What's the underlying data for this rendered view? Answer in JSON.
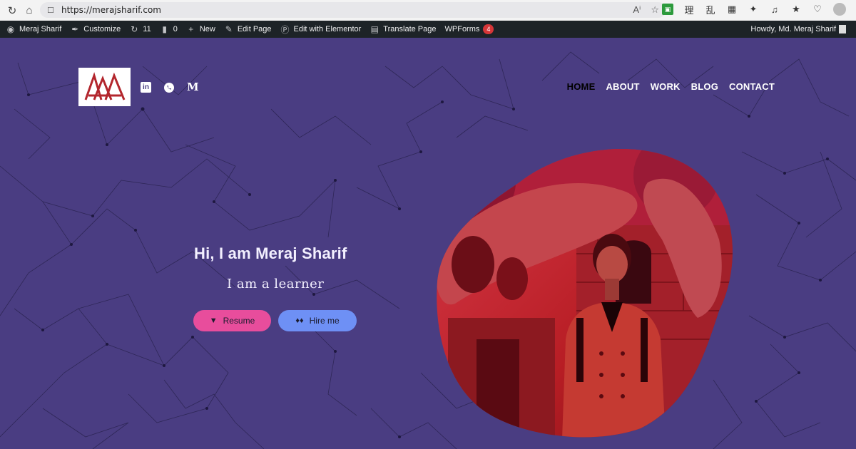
{
  "browser": {
    "url": "https://merajsharif.com",
    "back_icon": "refresh-icon",
    "home_icon": "home-icon"
  },
  "admin_bar": {
    "items": [
      {
        "label": "Meraj Sharif",
        "icon": "dashboard-icon"
      },
      {
        "label": "Customize",
        "icon": "brush-icon"
      },
      {
        "label": "11",
        "icon": "updates-icon"
      },
      {
        "label": "0",
        "icon": "comment-icon"
      },
      {
        "label": "New",
        "icon": "plus-icon"
      },
      {
        "label": "Edit Page",
        "icon": "pencil-icon"
      },
      {
        "label": "Edit with Elementor",
        "icon": "elementor-icon"
      },
      {
        "label": "Translate Page",
        "icon": "translate-icon"
      },
      {
        "label": "WPForms",
        "icon": "none",
        "badge": "4"
      }
    ],
    "greeting": "Howdy, Md. Meraj Sharif"
  },
  "site": {
    "nav": [
      {
        "label": "HOME",
        "active": true
      },
      {
        "label": "ABOUT",
        "active": false
      },
      {
        "label": "WORK",
        "active": false
      },
      {
        "label": "BLOG",
        "active": false
      },
      {
        "label": "CONTACT",
        "active": false
      }
    ],
    "social": {
      "linkedin": "in",
      "medium": "M"
    },
    "hero_title": "Hi, I am Meraj Sharif",
    "hero_subtitle": "I am a learner",
    "buttons": {
      "resume": "Resume",
      "hire": "Hire me"
    }
  },
  "colors": {
    "background": "#4a3d82",
    "resume_button": "#e84d9c",
    "hire_button": "#6e90f5",
    "admin_bar": "#1d2327",
    "logo_red": "#b3262d"
  }
}
